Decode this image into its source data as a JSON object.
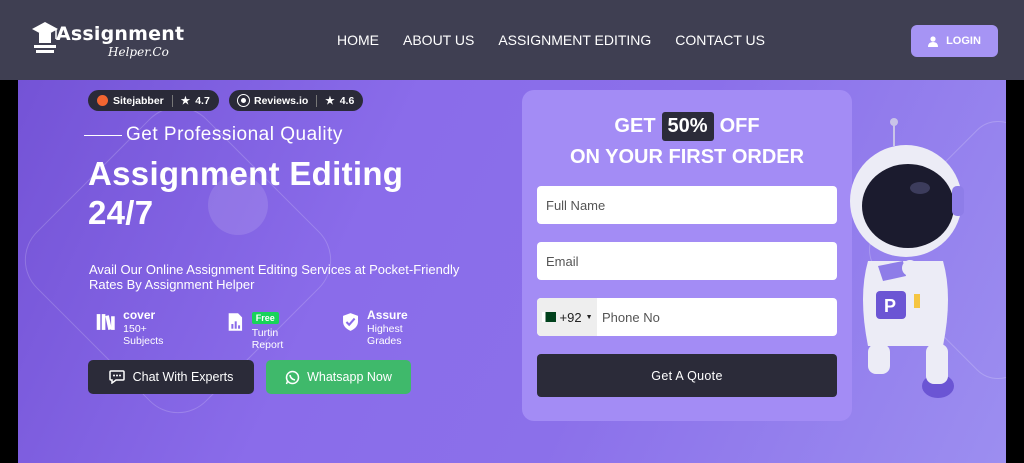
{
  "header": {
    "logo": {
      "line1": "Assignment",
      "line2": "Helper.Co"
    },
    "nav": [
      "HOME",
      "ABOUT US",
      "ASSIGNMENT EDITING",
      "CONTACT US"
    ],
    "login_label": "LOGIN"
  },
  "ratings": [
    {
      "name": "Sitejabber",
      "score": "4.7",
      "color": "#f26531"
    },
    {
      "name": "Reviews.io",
      "score": "4.6",
      "color": "#ffffff"
    }
  ],
  "hero": {
    "subheading": "Get Professional Quality",
    "title_line1": "Assignment Editing",
    "title_line2": "24/7",
    "description": "Avail Our Online Assignment Editing Services at Pocket-Friendly Rates By Assignment Helper",
    "features": [
      {
        "title": "cover",
        "subtitle": "150+ Subjects",
        "icon": "books-icon"
      },
      {
        "badge": "Free",
        "subtitle": "Turtin Report",
        "icon": "report-icon"
      },
      {
        "title": "Assure",
        "subtitle": "Highest Grades",
        "icon": "shield-check-icon"
      }
    ],
    "chat_label": "Chat With Experts",
    "whatsapp_label": "Whatsapp Now"
  },
  "form": {
    "offer_pre": "GET",
    "offer_pct": "50%",
    "offer_post": "OFF",
    "offer_line2": "ON YOUR FIRST ORDER",
    "name_placeholder": "Full Name",
    "email_placeholder": "Email",
    "country_code": "+92",
    "phone_placeholder": "Phone No",
    "submit_label": "Get A Quote"
  },
  "colors": {
    "header_bg": "#3f3f52",
    "accent": "#a694f4",
    "dark_button": "#2b2b39",
    "whatsapp": "#3fb96b"
  }
}
